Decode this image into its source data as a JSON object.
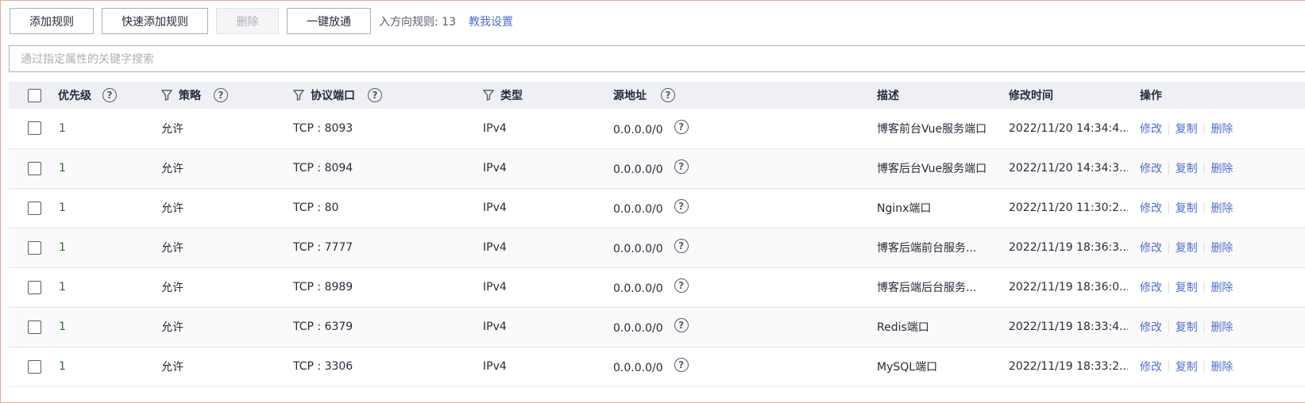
{
  "toolbar": {
    "add_rule": "添加规则",
    "quick_add_rule": "快速添加规则",
    "delete": "删除",
    "one_click_open": "一键放通",
    "rule_count": "入方向规则: 13",
    "help_link": "教我设置"
  },
  "search": {
    "placeholder": "通过指定属性的关键字搜索"
  },
  "table": {
    "headers": {
      "priority": "优先级",
      "policy": "策略",
      "protocol_port": "协议端口",
      "type": "类型",
      "source": "源地址",
      "description": "描述",
      "modified": "修改时间",
      "actions": "操作"
    },
    "actions": {
      "edit": "修改",
      "copy": "复制",
      "delete": "删除"
    },
    "rows": [
      {
        "priority": "1",
        "policy": "允许",
        "port": "TCP : 8093",
        "type": "IPv4",
        "source": "0.0.0.0/0",
        "description": "博客前台Vue服务端口",
        "modified": "2022/11/20 14:34:4..."
      },
      {
        "priority": "1",
        "policy": "允许",
        "port": "TCP : 8094",
        "type": "IPv4",
        "source": "0.0.0.0/0",
        "description": "博客后台Vue服务端口",
        "modified": "2022/11/20 14:34:3..."
      },
      {
        "priority": "1",
        "policy": "允许",
        "port": "TCP : 80",
        "type": "IPv4",
        "source": "0.0.0.0/0",
        "description": "Nginx端口",
        "modified": "2022/11/20 11:30:2..."
      },
      {
        "priority": "1",
        "policy": "允许",
        "port": "TCP : 7777",
        "type": "IPv4",
        "source": "0.0.0.0/0",
        "description": "博客后端前台服务...",
        "modified": "2022/11/19 18:36:3..."
      },
      {
        "priority": "1",
        "policy": "允许",
        "port": "TCP : 8989",
        "type": "IPv4",
        "source": "0.0.0.0/0",
        "description": "博客后端后台服务...",
        "modified": "2022/11/19 18:36:0..."
      },
      {
        "priority": "1",
        "policy": "允许",
        "port": "TCP : 6379",
        "type": "IPv4",
        "source": "0.0.0.0/0",
        "description": "Redis端口",
        "modified": "2022/11/19 18:33:4..."
      },
      {
        "priority": "1",
        "policy": "允许",
        "port": "TCP : 3306",
        "type": "IPv4",
        "source": "0.0.0.0/0",
        "description": "MySQL端口",
        "modified": "2022/11/19 18:33:2..."
      }
    ]
  },
  "colors": {
    "link": "#526ecc",
    "header_bg": "#eef0f5",
    "border": "#adb0b8"
  }
}
